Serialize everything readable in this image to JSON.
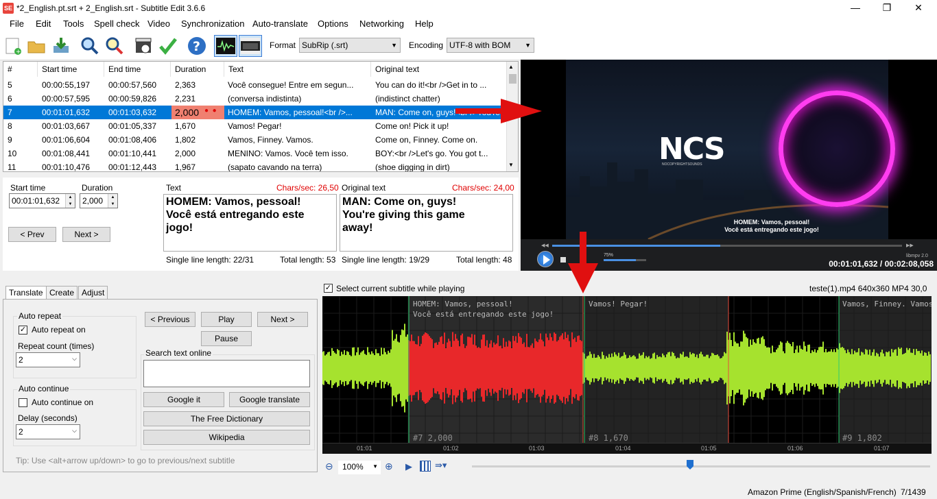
{
  "window": {
    "title": "*2_English.pt.srt + 2_English.srt - Subtitle Edit 3.6.6",
    "app_icon": "SE"
  },
  "menu": [
    "File",
    "Edit",
    "Tools",
    "Spell check",
    "Video",
    "Synchronization",
    "Auto-translate",
    "Options",
    "Networking",
    "Help"
  ],
  "toolbar": {
    "format_label": "Format",
    "format_value": "SubRip (.srt)",
    "encoding_label": "Encoding",
    "encoding_value": "UTF-8 with BOM"
  },
  "grid": {
    "headers": [
      "#",
      "Start time",
      "End time",
      "Duration",
      "Text",
      "Original text"
    ],
    "rows": [
      {
        "n": "5",
        "start": "00:00:55,197",
        "end": "00:00:57,560",
        "dur": "2,363",
        "text": "Você consegue!  Entre em segun...",
        "orig": "You can do it!<br />Get in to ..."
      },
      {
        "n": "6",
        "start": "00:00:57,595",
        "end": "00:00:59,826",
        "dur": "2,231",
        "text": "(conversa indistinta)",
        "orig": "(indistinct chatter)"
      },
      {
        "n": "7",
        "start": "00:01:01,632",
        "end": "00:01:03,632",
        "dur": "2,000",
        "text": "HOMEM: Vamos, pessoal!<br />...",
        "orig": "MAN: Come on, guys!<br />You're ..."
      },
      {
        "n": "8",
        "start": "00:01:03,667",
        "end": "00:01:05,337",
        "dur": "1,670",
        "text": "Vamos!  Pegar!",
        "orig": "Come on! Pick it up!"
      },
      {
        "n": "9",
        "start": "00:01:06,604",
        "end": "00:01:08,406",
        "dur": "1,802",
        "text": "Vamos, Finney.  Vamos.",
        "orig": "Come on, Finney. Come on."
      },
      {
        "n": "10",
        "start": "00:01:08,441",
        "end": "00:01:10,441",
        "dur": "2,000",
        "text": "MENINO: Vamos.  Você tem isso.",
        "orig": "BOY:<br />Let's go. You got t..."
      },
      {
        "n": "11",
        "start": "00:01:10,476",
        "end": "00:01:12,443",
        "dur": "1,967",
        "text": "(sapato cavando na terra)",
        "orig": "(shoe digging in dirt)"
      }
    ]
  },
  "editor": {
    "start_label": "Start time",
    "start_value": "00:01:01,632",
    "duration_label": "Duration",
    "duration_value": "2,000",
    "prev_btn": "< Prev",
    "next_btn": "Next >",
    "text_label": "Text",
    "text_cps": "Chars/sec: 26,50",
    "text_value_l1": "HOMEM: Vamos, pessoal!",
    "text_value_l2": "Você está entregando este",
    "text_value_l3": "jogo!",
    "text_single": "Single line length: 22/31",
    "text_total": "Total length: 53",
    "orig_label": "Original text",
    "orig_cps": "Chars/sec: 24,00",
    "orig_value_l1": "MAN: Come on, guys!",
    "orig_value_l2": "You're giving this game",
    "orig_value_l3": "away!",
    "orig_single": "Single line length: 19/29",
    "orig_total": "Total length: 48"
  },
  "video": {
    "logo": "NCS",
    "logo_sub": "NOCOPYRIGHTSOUNDS",
    "sub_l1": "HOMEM: Vamos, pessoal!",
    "sub_l2": "Você está entregando este jogo!",
    "volume": "75%",
    "player": "libmpv 2.0",
    "time": "00:01:01,632 / 00:02:08,058"
  },
  "tabs": [
    "Translate",
    "Create",
    "Adjust"
  ],
  "translate": {
    "auto_repeat_group": "Auto repeat",
    "auto_repeat_on": "Auto repeat on",
    "repeat_count_label": "Repeat count (times)",
    "repeat_count_value": "2",
    "auto_continue_group": "Auto continue",
    "auto_continue_on": "Auto continue on",
    "delay_label": "Delay (seconds)",
    "delay_value": "2",
    "prev_btn": "< Previous",
    "play_btn": "Play",
    "next_btn": "Next >",
    "pause_btn": "Pause",
    "search_group": "Search text online",
    "google_it": "Google it",
    "google_translate": "Google translate",
    "free_dictionary": "The Free Dictionary",
    "wikipedia": "Wikipedia",
    "tip": "Tip: Use <alt+arrow up/down> to go to previous/next subtitle"
  },
  "waveform": {
    "select_current": "Select current subtitle while playing",
    "video_info": "teste(1).mp4 640x360 MP4 30,0",
    "sub7_l1": "HOMEM: Vamos, pessoal!",
    "sub7_l2": "Você está entregando este jogo!",
    "sub8": "Vamos!  Pegar!",
    "sub9": "Vamos, Finney.  Vamos.",
    "label7": "#7  2,000",
    "label8": "#8  1,670",
    "label9": "#9  1,802",
    "ticks": [
      "01:01",
      "01:02",
      "01:03",
      "01:04",
      "01:05",
      "01:06",
      "01:07"
    ],
    "zoom": "100%"
  },
  "status": {
    "profile": "Amazon Prime (English/Spanish/French)",
    "position": "7/1439"
  },
  "colors": {
    "selection": "#0078d7",
    "wave_green": "#a6e22e",
    "wave_red": "#e8282a",
    "annotation_red": "#e01010"
  }
}
